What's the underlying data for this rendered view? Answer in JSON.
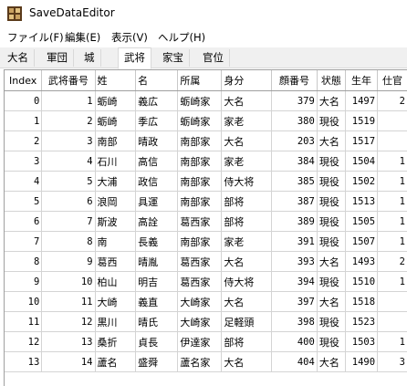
{
  "window": {
    "title": "SaveDataEditor"
  },
  "menu": [
    "ファイル(F)",
    "編集(E)",
    "表示(V)",
    "ヘルプ(H)"
  ],
  "tabs": [
    {
      "label": "大名",
      "active": false
    },
    {
      "label": "軍団",
      "active": false
    },
    {
      "label": "城",
      "active": false
    },
    {
      "label": "武将",
      "active": true
    },
    {
      "label": "家宝",
      "active": false
    },
    {
      "label": "官位",
      "active": false
    }
  ],
  "grid": {
    "columns": [
      "Index",
      "武将番号",
      "姓",
      "名",
      "所属",
      "身分",
      "顔番号",
      "状態",
      "生年",
      "仕官"
    ],
    "rows": [
      {
        "index": "0",
        "id": "1",
        "sei": "蛎崎",
        "mei": "義広",
        "shozoku": "蛎崎家",
        "mibun": "大名",
        "kao": "379",
        "jotai": "大名",
        "seinen": "1497",
        "shikan": "2"
      },
      {
        "index": "1",
        "id": "2",
        "sei": "蛎崎",
        "mei": "季広",
        "shozoku": "蛎崎家",
        "mibun": "家老",
        "kao": "380",
        "jotai": "現役",
        "seinen": "1519",
        "shikan": ""
      },
      {
        "index": "2",
        "id": "3",
        "sei": "南部",
        "mei": "晴政",
        "shozoku": "南部家",
        "mibun": "大名",
        "kao": "203",
        "jotai": "大名",
        "seinen": "1517",
        "shikan": ""
      },
      {
        "index": "3",
        "id": "4",
        "sei": "石川",
        "mei": "高信",
        "shozoku": "南部家",
        "mibun": "家老",
        "kao": "384",
        "jotai": "現役",
        "seinen": "1504",
        "shikan": "1"
      },
      {
        "index": "4",
        "id": "5",
        "sei": "大浦",
        "mei": "政信",
        "shozoku": "南部家",
        "mibun": "侍大将",
        "kao": "385",
        "jotai": "現役",
        "seinen": "1502",
        "shikan": "1"
      },
      {
        "index": "5",
        "id": "6",
        "sei": "浪岡",
        "mei": "具運",
        "shozoku": "南部家",
        "mibun": "部将",
        "kao": "387",
        "jotai": "現役",
        "seinen": "1513",
        "shikan": "1"
      },
      {
        "index": "6",
        "id": "7",
        "sei": "斯波",
        "mei": "高詮",
        "shozoku": "葛西家",
        "mibun": "部将",
        "kao": "389",
        "jotai": "現役",
        "seinen": "1505",
        "shikan": "1"
      },
      {
        "index": "7",
        "id": "8",
        "sei": "南",
        "mei": "長義",
        "shozoku": "南部家",
        "mibun": "家老",
        "kao": "391",
        "jotai": "現役",
        "seinen": "1507",
        "shikan": "1"
      },
      {
        "index": "8",
        "id": "9",
        "sei": "葛西",
        "mei": "晴胤",
        "shozoku": "葛西家",
        "mibun": "大名",
        "kao": "393",
        "jotai": "大名",
        "seinen": "1493",
        "shikan": "2"
      },
      {
        "index": "9",
        "id": "10",
        "sei": "柏山",
        "mei": "明吉",
        "shozoku": "葛西家",
        "mibun": "侍大将",
        "kao": "394",
        "jotai": "現役",
        "seinen": "1510",
        "shikan": "1"
      },
      {
        "index": "10",
        "id": "11",
        "sei": "大崎",
        "mei": "義直",
        "shozoku": "大崎家",
        "mibun": "大名",
        "kao": "397",
        "jotai": "大名",
        "seinen": "1518",
        "shikan": ""
      },
      {
        "index": "11",
        "id": "12",
        "sei": "黒川",
        "mei": "晴氏",
        "shozoku": "大崎家",
        "mibun": "足軽頭",
        "kao": "398",
        "jotai": "現役",
        "seinen": "1523",
        "shikan": ""
      },
      {
        "index": "12",
        "id": "13",
        "sei": "桑折",
        "mei": "貞長",
        "shozoku": "伊達家",
        "mibun": "部将",
        "kao": "400",
        "jotai": "現役",
        "seinen": "1503",
        "shikan": "1"
      },
      {
        "index": "13",
        "id": "14",
        "sei": "蘆名",
        "mei": "盛舜",
        "shozoku": "蘆名家",
        "mibun": "大名",
        "kao": "404",
        "jotai": "大名",
        "seinen": "1490",
        "shikan": "3"
      }
    ]
  }
}
